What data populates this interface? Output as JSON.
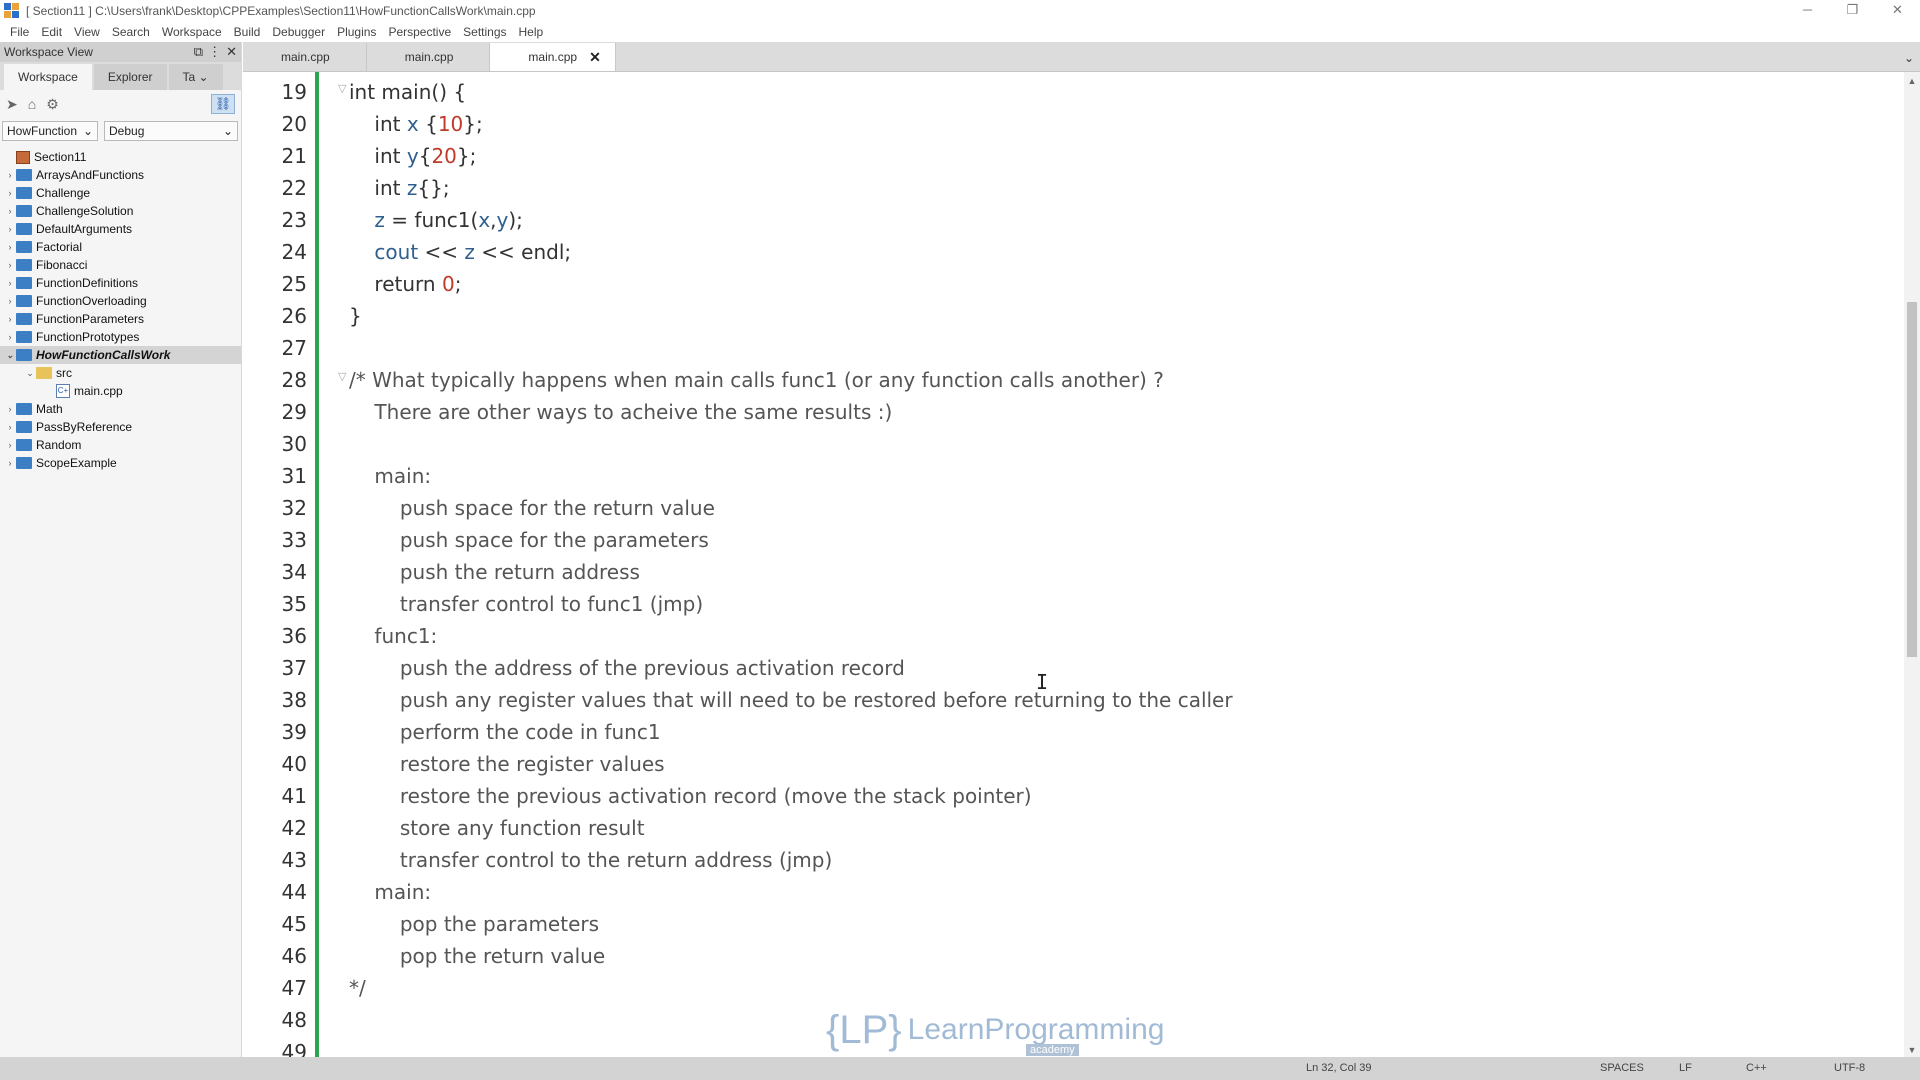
{
  "window": {
    "title": "[ Section11 ] C:\\Users\\frank\\Desktop\\CPPExamples\\Section11\\HowFunctionCallsWork\\main.cpp",
    "minimize": "─",
    "restore": "❐",
    "close": "✕"
  },
  "menu": [
    "File",
    "Edit",
    "View",
    "Search",
    "Workspace",
    "Build",
    "Debugger",
    "Plugins",
    "Perspective",
    "Settings",
    "Help"
  ],
  "workspace": {
    "header": "Workspace View",
    "tabs": [
      "Workspace",
      "Explorer",
      "Ta"
    ],
    "project_select": "HowFunction",
    "config_select": "Debug",
    "tree": [
      {
        "label": "Section11",
        "kind": "root",
        "arrow": "",
        "indent": 0
      },
      {
        "label": "ArraysAndFunctions",
        "kind": "folder",
        "arrow": "›",
        "indent": 1
      },
      {
        "label": "Challenge",
        "kind": "folder",
        "arrow": "›",
        "indent": 1
      },
      {
        "label": "ChallengeSolution",
        "kind": "folder",
        "arrow": "›",
        "indent": 1
      },
      {
        "label": "DefaultArguments",
        "kind": "folder",
        "arrow": "›",
        "indent": 1
      },
      {
        "label": "Factorial",
        "kind": "folder",
        "arrow": "›",
        "indent": 1
      },
      {
        "label": "Fibonacci",
        "kind": "folder",
        "arrow": "›",
        "indent": 1
      },
      {
        "label": "FunctionDefinitions",
        "kind": "folder",
        "arrow": "›",
        "indent": 1
      },
      {
        "label": "FunctionOverloading",
        "kind": "folder",
        "arrow": "›",
        "indent": 1
      },
      {
        "label": "FunctionParameters",
        "kind": "folder",
        "arrow": "›",
        "indent": 1
      },
      {
        "label": "FunctionPrototypes",
        "kind": "folder",
        "arrow": "›",
        "indent": 1
      },
      {
        "label": "HowFunctionCallsWork",
        "kind": "folder",
        "arrow": "⌄",
        "indent": 1,
        "selected": true
      },
      {
        "label": "src",
        "kind": "folder-yellow",
        "arrow": "⌄",
        "indent": 2
      },
      {
        "label": "main.cpp",
        "kind": "file",
        "arrow": "",
        "indent": 3
      },
      {
        "label": "Math",
        "kind": "folder",
        "arrow": "›",
        "indent": 1
      },
      {
        "label": "PassByReference",
        "kind": "folder",
        "arrow": "›",
        "indent": 1
      },
      {
        "label": "Random",
        "kind": "folder",
        "arrow": "›",
        "indent": 1
      },
      {
        "label": "ScopeExample",
        "kind": "folder",
        "arrow": "›",
        "indent": 1
      }
    ]
  },
  "editor_tabs": [
    {
      "label": "main.cpp",
      "active": false
    },
    {
      "label": "main.cpp",
      "active": false
    },
    {
      "label": "main.cpp",
      "active": true
    }
  ],
  "code_lines": [
    {
      "n": "19",
      "tokens": [
        [
          "kw",
          "int main() {"
        ]
      ]
    },
    {
      "n": "20",
      "tokens": [
        [
          "kw",
          "    int "
        ],
        [
          "var",
          "x"
        ],
        [
          "kw",
          " {"
        ],
        [
          "nm",
          "10"
        ],
        [
          "kw",
          "};"
        ]
      ]
    },
    {
      "n": "21",
      "tokens": [
        [
          "kw",
          "    int "
        ],
        [
          "var",
          "y"
        ],
        [
          "kw",
          "{"
        ],
        [
          "nm",
          "20"
        ],
        [
          "kw",
          "};"
        ]
      ]
    },
    {
      "n": "22",
      "tokens": [
        [
          "kw",
          "    int "
        ],
        [
          "var",
          "z"
        ],
        [
          "kw",
          "{};"
        ]
      ]
    },
    {
      "n": "23",
      "tokens": [
        [
          "var",
          "    z"
        ],
        [
          "kw",
          " = func1("
        ],
        [
          "var",
          "x"
        ],
        [
          "kw",
          ","
        ],
        [
          "var",
          "y"
        ],
        [
          "kw",
          ");"
        ]
      ]
    },
    {
      "n": "24",
      "tokens": [
        [
          "var",
          "    cout"
        ],
        [
          "kw",
          " << "
        ],
        [
          "var",
          "z"
        ],
        [
          "kw",
          " << endl;"
        ]
      ]
    },
    {
      "n": "25",
      "tokens": [
        [
          "kw",
          "    return "
        ],
        [
          "nm",
          "0"
        ],
        [
          "kw",
          ";"
        ]
      ]
    },
    {
      "n": "26",
      "tokens": [
        [
          "kw",
          "}"
        ]
      ]
    },
    {
      "n": "27",
      "tokens": [
        [
          "kw",
          ""
        ]
      ]
    },
    {
      "n": "28",
      "tokens": [
        [
          "cm",
          "/* What typically happens when main calls func1 (or any function calls another) ?"
        ]
      ]
    },
    {
      "n": "29",
      "tokens": [
        [
          "cm",
          "    There are other ways to acheive the same results :)"
        ]
      ]
    },
    {
      "n": "30",
      "tokens": [
        [
          "cm",
          ""
        ]
      ]
    },
    {
      "n": "31",
      "tokens": [
        [
          "cm",
          "    main:"
        ]
      ]
    },
    {
      "n": "32",
      "tokens": [
        [
          "cm",
          "        push space for the return value"
        ]
      ]
    },
    {
      "n": "33",
      "tokens": [
        [
          "cm",
          "        push space for the parameters"
        ]
      ]
    },
    {
      "n": "34",
      "tokens": [
        [
          "cm",
          "        push the return address"
        ]
      ]
    },
    {
      "n": "35",
      "tokens": [
        [
          "cm",
          "        transfer control to func1 (jmp)"
        ]
      ]
    },
    {
      "n": "36",
      "tokens": [
        [
          "cm",
          "    func1:"
        ]
      ]
    },
    {
      "n": "37",
      "tokens": [
        [
          "cm",
          "        push the address of the previous activation record"
        ]
      ]
    },
    {
      "n": "38",
      "tokens": [
        [
          "cm",
          "        push any register values that will need to be restored before returning to the caller"
        ]
      ]
    },
    {
      "n": "39",
      "tokens": [
        [
          "cm",
          "        perform the code in func1"
        ]
      ]
    },
    {
      "n": "40",
      "tokens": [
        [
          "cm",
          "        restore the register values"
        ]
      ]
    },
    {
      "n": "41",
      "tokens": [
        [
          "cm",
          "        restore the previous activation record (move the stack pointer)"
        ]
      ]
    },
    {
      "n": "42",
      "tokens": [
        [
          "cm",
          "        store any function result"
        ]
      ]
    },
    {
      "n": "43",
      "tokens": [
        [
          "cm",
          "        transfer control to the return address (jmp)"
        ]
      ]
    },
    {
      "n": "44",
      "tokens": [
        [
          "cm",
          "    main:"
        ]
      ]
    },
    {
      "n": "45",
      "tokens": [
        [
          "cm",
          "        pop the parameters"
        ]
      ]
    },
    {
      "n": "46",
      "tokens": [
        [
          "cm",
          "        pop the return value"
        ]
      ]
    },
    {
      "n": "47",
      "tokens": [
        [
          "cm",
          "*/"
        ]
      ]
    },
    {
      "n": "48",
      "tokens": [
        [
          "cm",
          ""
        ]
      ]
    },
    {
      "n": "49",
      "tokens": [
        [
          "cm",
          ""
        ]
      ]
    }
  ],
  "logo": {
    "text": "LearnProgramming",
    "sub": "academy",
    "brace": "{LP}"
  },
  "status": {
    "position": "Ln 32, Col 39",
    "indent": "SPACES",
    "eol": "LF",
    "lang": "C++",
    "encoding": "UTF-8"
  },
  "colors": {
    "change_bar": "#2da44e",
    "number": "#c03a2b",
    "identifier": "#2f5f8f"
  }
}
